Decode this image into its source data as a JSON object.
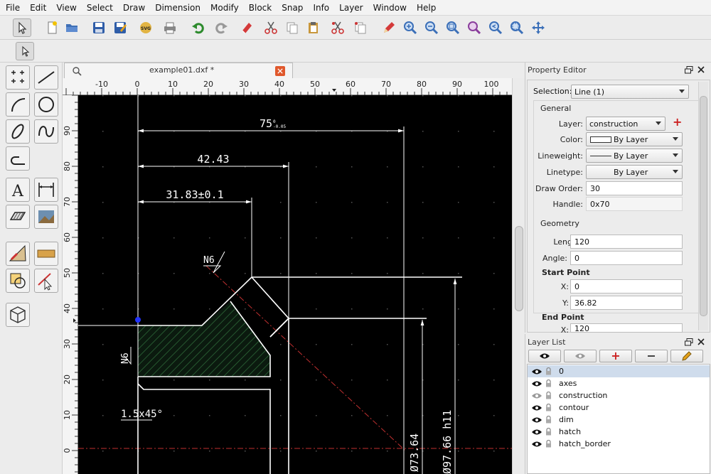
{
  "menu": [
    "File",
    "Edit",
    "View",
    "Select",
    "Draw",
    "Dimension",
    "Modify",
    "Block",
    "Snap",
    "Info",
    "Layer",
    "Window",
    "Help"
  ],
  "toolbar_icons": [
    "select-arrow-icon",
    "new-file-icon",
    "open-folder-icon",
    "save-icon",
    "save-as-icon",
    "export-svg-icon",
    "print-icon",
    "undo-icon",
    "redo-icon",
    "eraser-icon",
    "cut-icon",
    "copy-icon",
    "paste-icon",
    "cut-ref-icon",
    "copy-ref-icon",
    "pencil-icon",
    "zoom-in-icon",
    "zoom-out-icon",
    "zoom-auto-icon",
    "zoom-selection-icon",
    "zoom-previous-icon",
    "zoom-window-icon",
    "pan-icon"
  ],
  "toolbar_svg_label": "SVG",
  "tab": {
    "title": "example01.dxf *"
  },
  "ruler": {
    "x_labels": [
      "-10",
      "0",
      "10",
      "20",
      "30",
      "40",
      "50",
      "60",
      "70",
      "80",
      "90",
      "100"
    ],
    "y_labels": [
      "90",
      "80",
      "70",
      "60",
      "50",
      "40",
      "30",
      "20",
      "10",
      "0"
    ]
  },
  "drawing": {
    "dim_75": "75",
    "dim_75_tol_upper": "0",
    "dim_75_tol_lower": "-0.05",
    "dim_42": "42.43",
    "dim_31": "31.83±0.1",
    "surface_n6_top": "N6",
    "surface_n6_left": "N6",
    "chamfer": "1.5x45°",
    "dia_73": "Ø73.64",
    "dia_97": "Ø97.66 h11"
  },
  "property_editor": {
    "title": "Property Editor",
    "selection_label": "Selection:",
    "selection_value": "Line (1)",
    "general": "General",
    "layer_label": "Layer:",
    "layer_value": "construction",
    "color_label": "Color:",
    "color_value": "By Layer",
    "lineweight_label": "Lineweight:",
    "lineweight_value": "By Layer",
    "linetype_label": "Linetype:",
    "linetype_value": "By Layer",
    "draworder_label": "Draw Order:",
    "draworder_value": "30",
    "handle_label": "Handle:",
    "handle_value": "0x70",
    "geometry": "Geometry",
    "length_label": "Length:",
    "length_value": "120",
    "angle_label": "Angle:",
    "angle_value": "0",
    "start_point": "Start Point",
    "sx_label": "X:",
    "sx_value": "0",
    "sy_label": "Y:",
    "sy_value": "36.82",
    "end_point": "End Point",
    "ex_label": "X:",
    "ex_value": "120"
  },
  "layer_list": {
    "title": "Layer List",
    "layers": [
      {
        "name": "0",
        "visible": true
      },
      {
        "name": "axes",
        "visible": true
      },
      {
        "name": "construction",
        "visible": false
      },
      {
        "name": "contour",
        "visible": true
      },
      {
        "name": "dim",
        "visible": true
      },
      {
        "name": "hatch",
        "visible": true
      },
      {
        "name": "hatch_border",
        "visible": true
      }
    ]
  },
  "colors": {
    "accent_red": "#cc2222",
    "drawing_bg": "#000000",
    "hatch": "#2e6b3a",
    "construction_line": "#c03030"
  }
}
